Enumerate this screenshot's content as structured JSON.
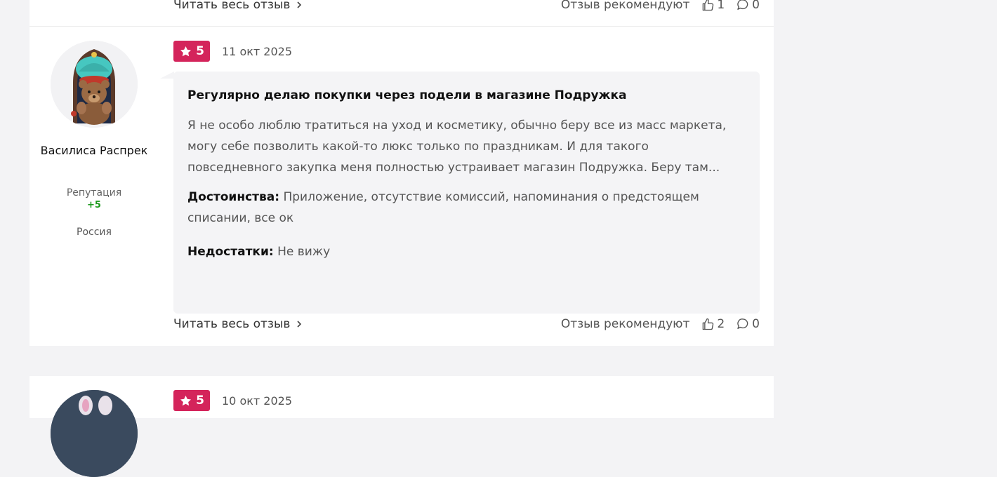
{
  "prev_review": {
    "read_more": "Читать весь отзыв",
    "recommend_label": "Отзыв рекомендуют",
    "likes": "1",
    "comments": "0"
  },
  "review": {
    "rating": "5",
    "date": "11 окт 2025",
    "author": {
      "name": "Василиса Распрек",
      "reputation_label": "Репутация",
      "reputation_value": "+5",
      "country": "Россия"
    },
    "title": "Регулярно делаю покупки через подели в магазине Подружка",
    "text": "Я не особо люблю тратиться на уход и косметику, обычно беру все из масс маркета, могу себе позволить какой-то люкс только по праздникам. И для такого повседневного закупка меня полностью устраивает магазин Подружка. Беру там...",
    "pros_label": "Достоинства:",
    "pros_text": "Приложение, отсутствие комиссий, напоминания о предстоящем списании, все ок",
    "cons_label": "Недостатки:",
    "cons_text": "Не вижу",
    "read_more": "Читать весь отзыв",
    "recommend_label": "Отзыв рекомендуют",
    "likes": "2",
    "comments": "0"
  },
  "next_review": {
    "rating": "5",
    "date": "10 окт 2025"
  },
  "colors": {
    "rating_badge": "#d4245b",
    "reputation_positive": "#1d9a1d",
    "page_bg": "#f3f3f5",
    "bubble_bg": "#f4f4f6"
  }
}
